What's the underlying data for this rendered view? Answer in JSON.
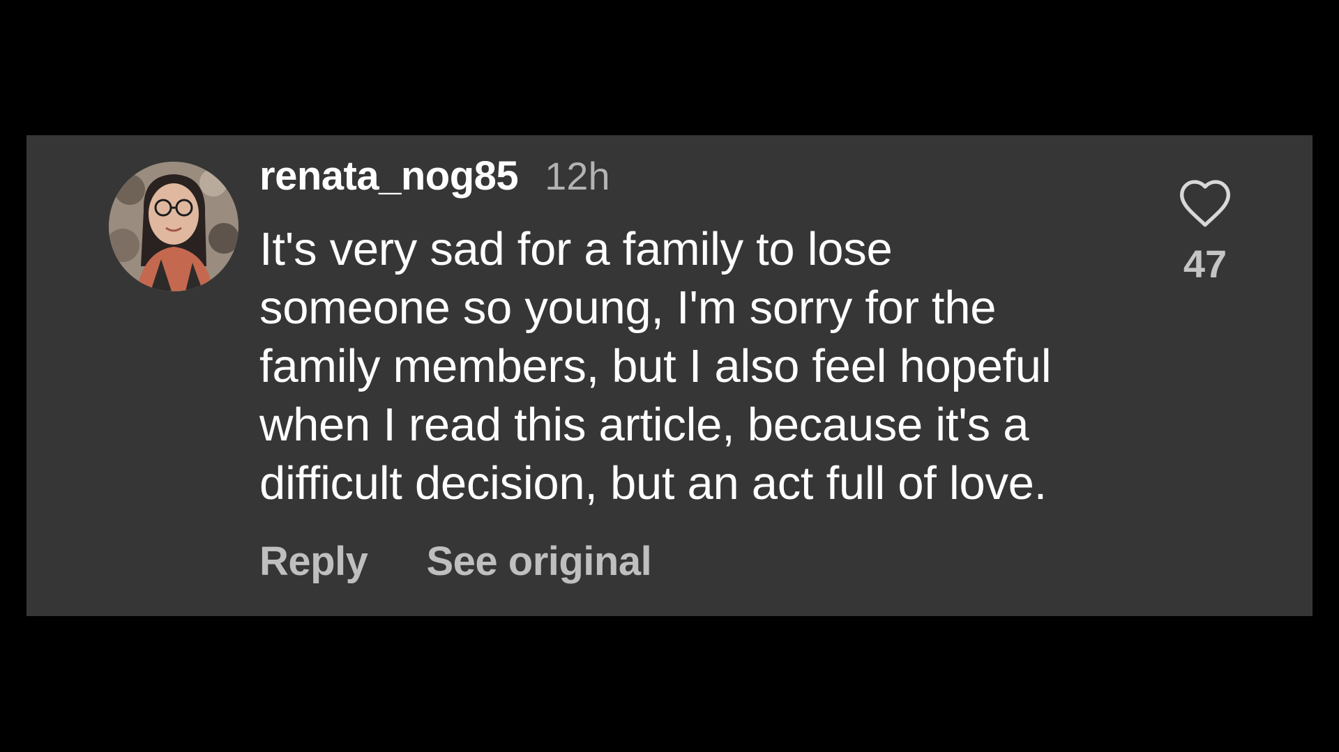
{
  "comment": {
    "username": "renata_nog85",
    "timestamp": "12h",
    "text": "It's very sad for a family to lose\nsomeone so young, I'm sorry for the\nfamily members, but I also feel hopeful\nwhen I read this article, because it's a\ndifficult decision, but an act full of love.",
    "actions": {
      "reply_label": "Reply",
      "see_original_label": "See original"
    },
    "likes": {
      "count": "47",
      "icon": "heart-outline-icon"
    }
  },
  "colors": {
    "page_background": "#000000",
    "card_background": "#363636",
    "primary_text": "#ffffff",
    "secondary_text": "#b3b3b3"
  }
}
